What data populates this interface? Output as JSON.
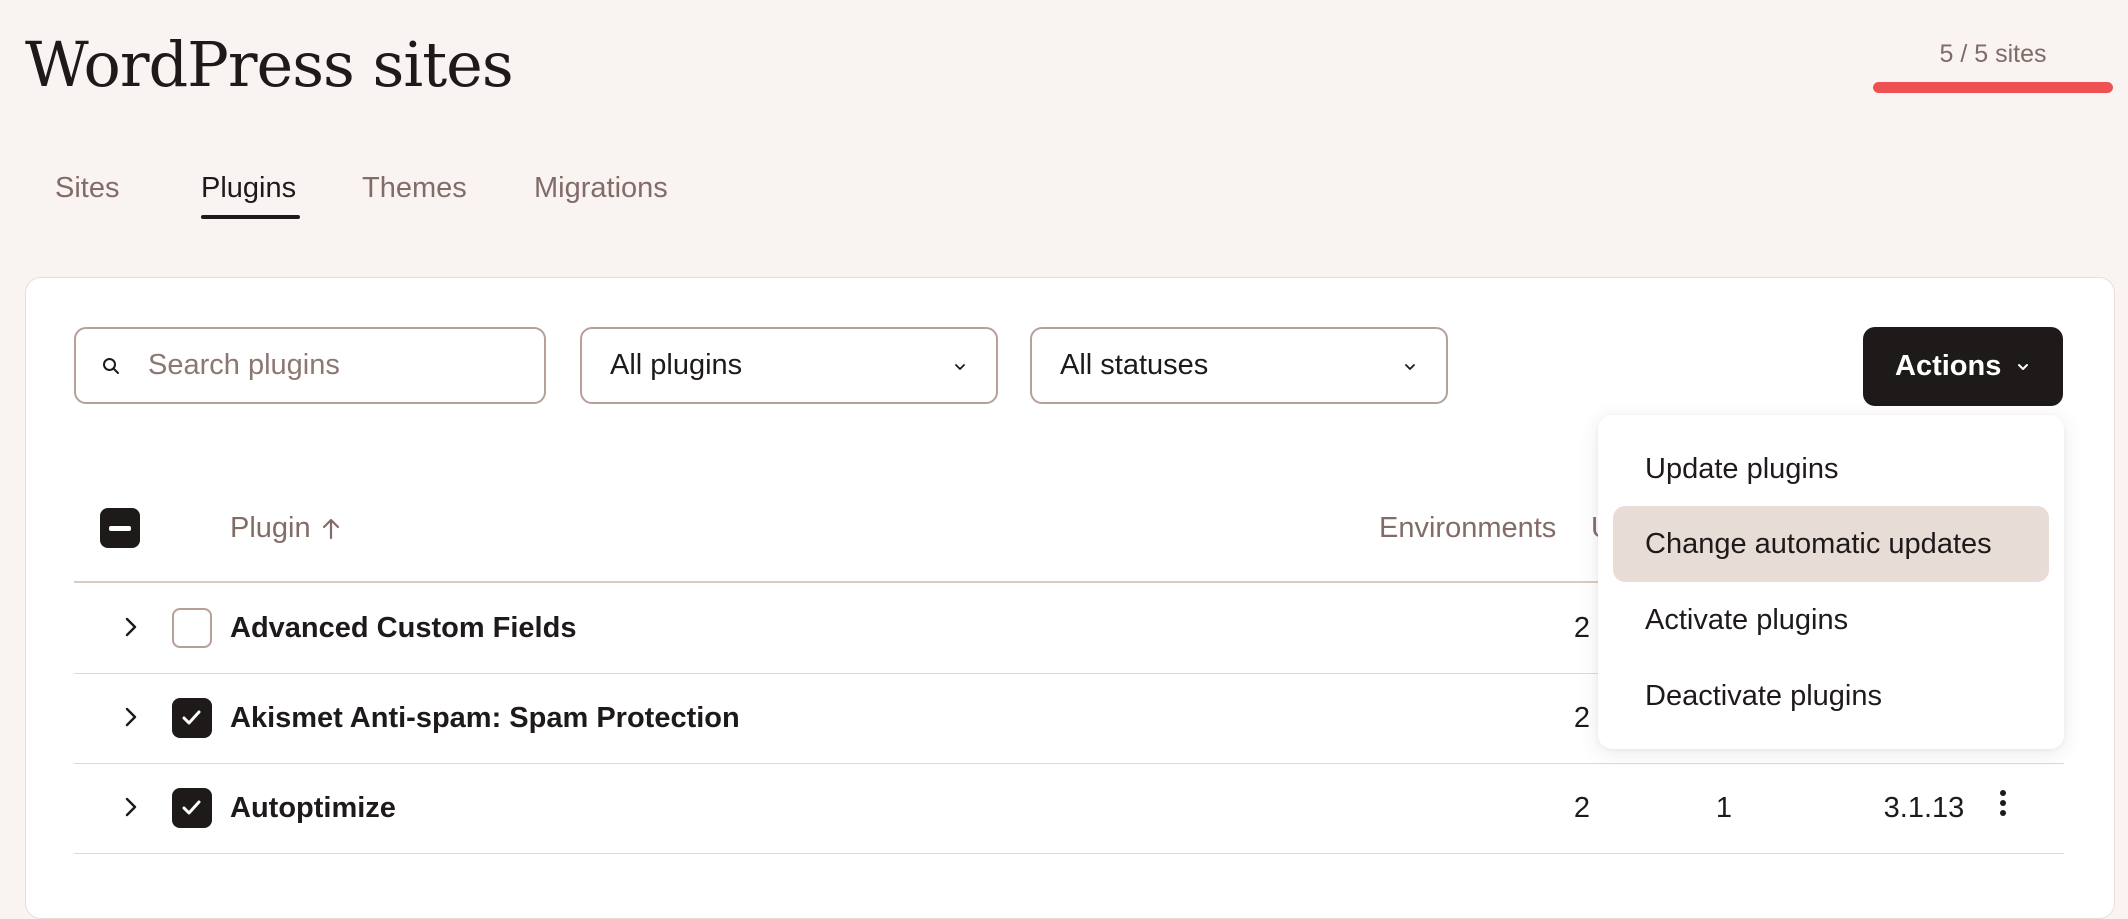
{
  "header": {
    "title": "WordPress sites",
    "site_count": "5 / 5 sites",
    "site_count_fraction": 1.0,
    "usage_color": "#ef5051"
  },
  "tabs": [
    {
      "label": "Sites",
      "active": false
    },
    {
      "label": "Plugins",
      "active": true
    },
    {
      "label": "Themes",
      "active": false
    },
    {
      "label": "Migrations",
      "active": false
    }
  ],
  "filters": {
    "search_placeholder": "Search plugins",
    "plugin_filter": "All plugins",
    "status_filter": "All statuses",
    "actions_label": "Actions"
  },
  "table": {
    "columns": {
      "plugin": "Plugin",
      "environments": "Environments",
      "updates_partial": "U"
    },
    "rows": [
      {
        "name": "Advanced Custom Fields",
        "checked": false,
        "environments": "2",
        "updates": "",
        "version": ""
      },
      {
        "name": "Akismet Anti-spam: Spam Protection",
        "checked": true,
        "environments": "2",
        "updates": "",
        "version": ""
      },
      {
        "name": "Autoptimize",
        "checked": true,
        "environments": "2",
        "updates": "1",
        "version": "3.1.13"
      }
    ]
  },
  "actions_menu": {
    "items": [
      {
        "label": "Update plugins"
      },
      {
        "label": "Change automatic updates",
        "highlighted": true
      },
      {
        "label": "Activate plugins"
      },
      {
        "label": "Deactivate plugins"
      }
    ]
  },
  "icons": {
    "search": "search-icon",
    "chevron_down": "chevron-down-icon",
    "chevron_right": "chevron-right-icon",
    "sort_asc": "arrow-up-icon",
    "checkmark": "check-icon",
    "more": "more-vertical-icon"
  }
}
